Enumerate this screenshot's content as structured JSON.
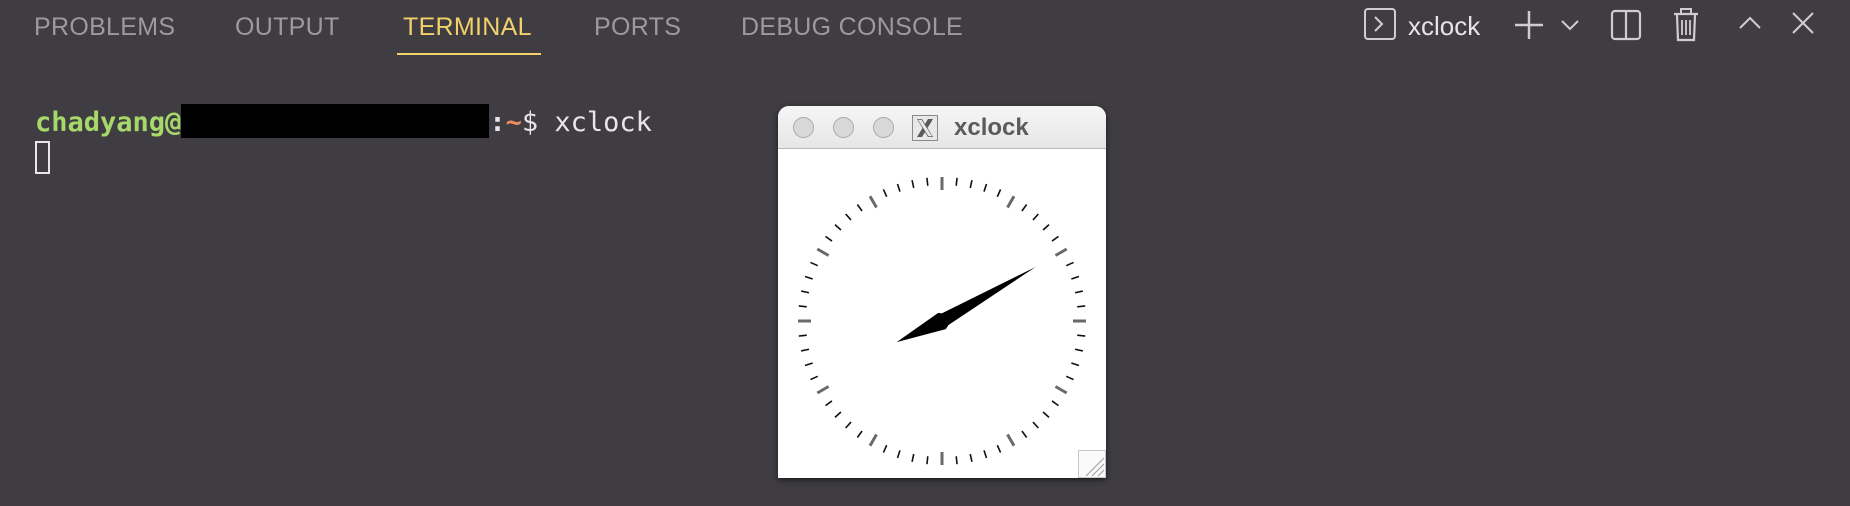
{
  "panel": {
    "tabs": [
      {
        "label": "PROBLEMS",
        "active": false
      },
      {
        "label": "OUTPUT",
        "active": false
      },
      {
        "label": "TERMINAL",
        "active": true
      },
      {
        "label": "PORTS",
        "active": false
      },
      {
        "label": "DEBUG CONSOLE",
        "active": false
      }
    ],
    "active_color": "#f2d16b",
    "terminal_name": "xclock",
    "icons": [
      "terminal-icon",
      "plus-icon",
      "chevron-down-icon",
      "split-icon",
      "trash-icon",
      "chevron-up-icon",
      "close-icon"
    ]
  },
  "terminal": {
    "user": "chadyang@",
    "colon": ":",
    "tilde": "~",
    "command": "$ xclock"
  },
  "xclock_window": {
    "title": "xclock",
    "icon": "x-window-icon",
    "clock": {
      "hour": 8,
      "minute": 10
    }
  }
}
